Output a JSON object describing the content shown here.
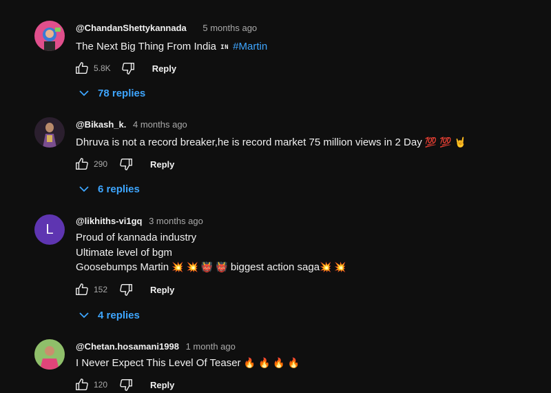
{
  "comments": [
    {
      "author": "@ChandanShettykannada",
      "time": "5 months ago",
      "text_before": "The Next Big Thing From India",
      "flag": "IN",
      "hashtag": "#Martin",
      "likes": "5.8K",
      "reply_label": "Reply",
      "replies_label": "78 replies"
    },
    {
      "author": "@Bikash_k.",
      "time": "4 months ago",
      "text": "Dhruva is not a record breaker,he is record market 75 million views in 2 Day",
      "emoji": "💯 💯 🤘",
      "likes": "290",
      "reply_label": "Reply",
      "replies_label": "6 replies"
    },
    {
      "author": "@likhiths-vi1gq",
      "time": "3 months ago",
      "avatar_letter": "L",
      "line1": "Proud of kannada industry",
      "line2": "Ultimate level of bgm",
      "line3_a": "Goosebumps Martin",
      "line3_emoji_a": "💥 💥 👹 👹",
      "line3_b": "biggest action saga",
      "line3_emoji_b": "💥 💥",
      "likes": "152",
      "reply_label": "Reply",
      "replies_label": "4 replies"
    },
    {
      "author": "@Chetan.hosamani1998",
      "time": "1 month ago",
      "text": "I Never Expect This Level Of Teaser",
      "emoji": "🔥 🔥 🔥 🔥",
      "likes": "120",
      "reply_label": "Reply"
    }
  ],
  "colors": {
    "background": "#0f0f0f",
    "link_blue": "#3ea6ff",
    "muted": "#aaaaaa",
    "avatar_purple": "#5e35b1"
  },
  "icons": [
    "thumbs-up-icon",
    "thumbs-down-icon",
    "chevron-down-icon"
  ]
}
